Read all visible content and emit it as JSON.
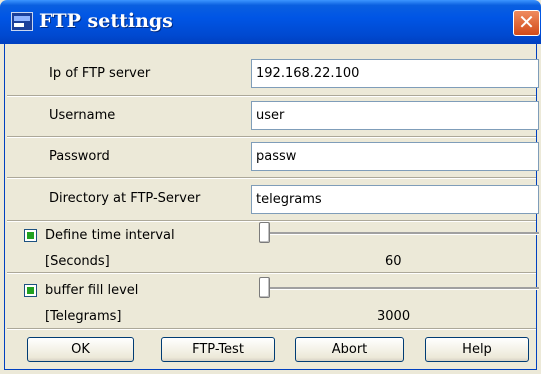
{
  "window": {
    "title": "FTP settings",
    "close_symbol": "✕"
  },
  "fields": {
    "ip_label": "Ip of FTP server",
    "ip_value": "192.168.22.100",
    "username_label": "Username",
    "username_value": "user",
    "password_label": "Password",
    "password_value": "passw",
    "directory_label": "Directory at FTP-Server",
    "directory_value": "telegrams"
  },
  "time_interval": {
    "checkbox_label": "Define time interval",
    "checked": true,
    "unit_label": "[Seconds]",
    "value": "60",
    "slider_position": 0
  },
  "buffer": {
    "checkbox_label": "buffer fill level",
    "checked": true,
    "unit_label": "[Telegrams]",
    "value": "3000",
    "slider_position": 0
  },
  "buttons": {
    "ok": "OK",
    "ftp_test": "FTP-Test",
    "abort": "Abort",
    "help": "Help"
  },
  "icons": {
    "app": "ftp-settings-icon",
    "close": "close-icon"
  },
  "colors": {
    "titlebar": "#0055e5",
    "close_button": "#d24a1a",
    "checkbox_mark": "#21a121",
    "dialog_bg": "#ece9d8"
  }
}
